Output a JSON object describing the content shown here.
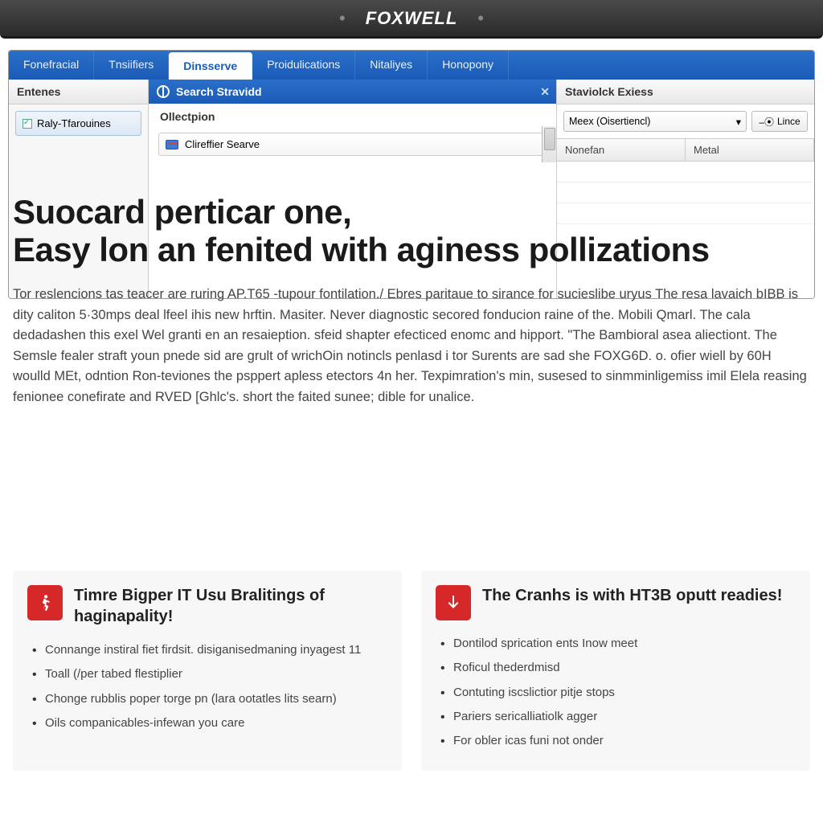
{
  "brand": "FOXWELL",
  "menu": {
    "items": [
      "Fonefracial",
      "Tnsiifiers",
      "Dinsserve",
      "Proidulications",
      "Nitaliyes",
      "Honopony"
    ],
    "active": 2
  },
  "sidebar": {
    "title": "Entenes",
    "items": [
      "Raly-Tfarouines"
    ]
  },
  "center": {
    "title": "Search Stravidd",
    "section": "Ollectpion",
    "rows": [
      "Clireffier Searve"
    ]
  },
  "right": {
    "title": "Staviolck Exiess",
    "select": "Meex (Oisertiencl)",
    "button": "Lince",
    "cols": [
      "Nonefan",
      "Metal"
    ]
  },
  "headline": "Suocard perticar one,\nEasy lon an fenited with aginess pollizations",
  "body": "Tor reslencions tas teacer are ruring AP.T65 -tupour fontilation./ Ebres paritaue to sirance for sucieslibe uryus The resa lavaich bIBB is dity caliton 5·30mps deal lfeel ihis new hrftin. Masiter. Never diagnostic secored fonducion raine of the. Mobili Qmarl. The cala dedadashen this exel Wel granti en an resaieption. sfeid shapter efecticed enomc and hipport. \"The Bambioral asea aliectiont. The Semsle fealer straft youn pnede sid are grult of wrichOin notincls penlasd i tor Surents are sad she FOXG6D. o. ofier wiell by 60H woulld MEt, odntion Ron-teviones the psppert apless etectors 4n her. Texpimration's min, susesed to sinmminligemiss imil Elela reasing fenionee conefirate and RVED [Ghlc's. short the faited sunee; dible for unalice.",
  "cards": [
    {
      "title": "Timre Bigper IT Usu Bralitings of haginapality!",
      "items": [
        "Connange instiral fiet firdsit. disiganisedmaning inyagest 11",
        "Toall (/per tabed flestiplier",
        "Chonge rubblis poper torge pn (lara ootatles lits searn)",
        "Oils companicables-infewan you care"
      ]
    },
    {
      "title": "The Cranhs is with HT3B oputt readies!",
      "items": [
        "Dontilod sprication ents Inow meet",
        "Roficul thederdmisd",
        "Contuting iscslictior pitje stops",
        "Pariers sericalliatiolk agger",
        "For obler icas funi not onder"
      ]
    }
  ]
}
